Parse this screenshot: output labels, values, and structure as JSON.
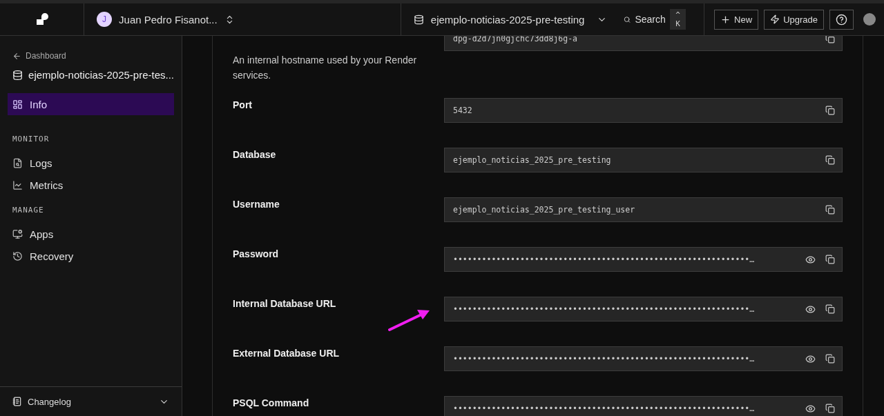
{
  "header": {
    "workspace": {
      "initial": "J",
      "name": "Juan Pedro Fisanot..."
    },
    "service": "ejemplo-noticias-2025-pre-testing",
    "search": {
      "label": "Search",
      "shortcut": "^ K"
    },
    "buttons": [
      {
        "kind": "new",
        "label": "New"
      },
      {
        "kind": "upgrade",
        "label": "Upgrade"
      },
      {
        "kind": "help"
      }
    ]
  },
  "sidebar": {
    "back": "Dashboard",
    "service": "ejemplo-noticias-2025-pre-tes...",
    "sections": [
      {
        "items": [
          {
            "kind": "info",
            "label": "Info",
            "selected": true
          }
        ]
      },
      {
        "title": "MONITOR",
        "items": [
          {
            "kind": "logs",
            "label": "Logs",
            "selected": false
          },
          {
            "kind": "metrics",
            "label": "Metrics",
            "selected": false
          }
        ]
      },
      {
        "title": "MANAGE",
        "items": [
          {
            "kind": "apps",
            "label": "Apps",
            "selected": false
          },
          {
            "kind": "recovery",
            "label": "Recovery",
            "selected": false
          }
        ]
      }
    ],
    "footer": "Changelog"
  },
  "fields": [
    {
      "description": "An internal hostname used by your Render services.",
      "value": "dpg-d2d7jn0gjchc73dd8j6g-a",
      "secret": false
    },
    {
      "label": "Port",
      "value": "5432",
      "secret": false
    },
    {
      "label": "Database",
      "value": "ejemplo_noticias_2025_pre_testing",
      "secret": false
    },
    {
      "label": "Username",
      "value": "ejemplo_noticias_2025_pre_testing_user",
      "secret": false
    },
    {
      "label": "Password",
      "value": "••••••••••••••••••••••••••••••••••••••••••••••••••••••••••••••…",
      "secret": true
    },
    {
      "label": "Internal Database URL",
      "value": "••••••••••••••••••••••••••••••••••••••••••••••••••••••••••••••…",
      "secret": true,
      "annotated": true
    },
    {
      "label": "External Database URL",
      "value": "••••••••••••••••••••••••••••••••••••••••••••••••••••••••••••••…",
      "secret": true
    },
    {
      "label": "PSQL Command",
      "value": "••••••••••••••••••••••••••••••••••••••••••••••••••••••••••••••…",
      "secret": true
    }
  ]
}
